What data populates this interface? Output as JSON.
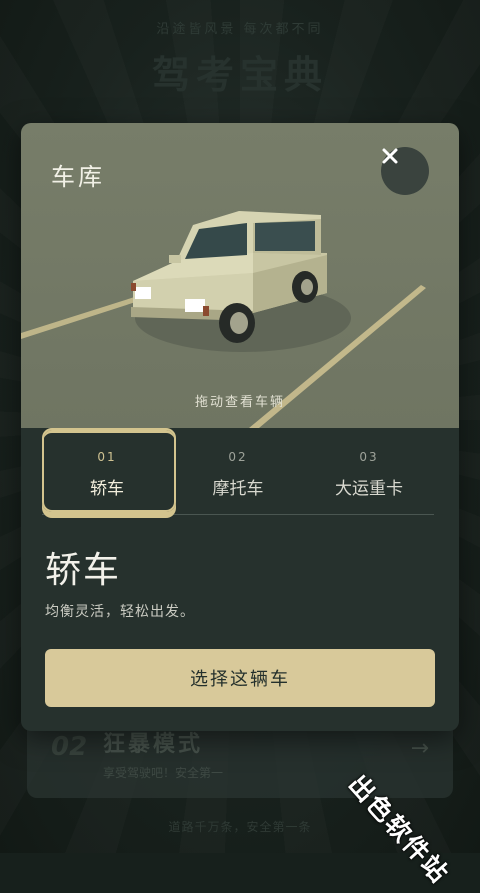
{
  "background": {
    "slogan": "沿途皆风景    每次都不同",
    "title": "驾考宝典",
    "card": {
      "number": "02",
      "title": "狂暴模式",
      "subtitle": "享受驾驶吧！安全第一",
      "arrow": "→"
    },
    "footer": "道路千万条，安全第一条"
  },
  "modal": {
    "title": "车库",
    "close_icon": "×",
    "hint": "拖动查看车辆",
    "tabs": [
      {
        "number": "01",
        "name": "轿车",
        "active": true
      },
      {
        "number": "02",
        "name": "摩托车",
        "active": false
      },
      {
        "number": "03",
        "name": "大运重卡",
        "active": false
      }
    ],
    "selected_name": "轿车",
    "selected_desc": "均衡灵活，轻松出发。",
    "select_button": "选择这辆车"
  },
  "watermark": "出色软件站",
  "colors": {
    "accent": "#d8c99a",
    "modal_bg": "#26312d",
    "preview_bg": "#777d69",
    "car_body": "#c8c6a3",
    "road_line": "#cbbf8f"
  }
}
